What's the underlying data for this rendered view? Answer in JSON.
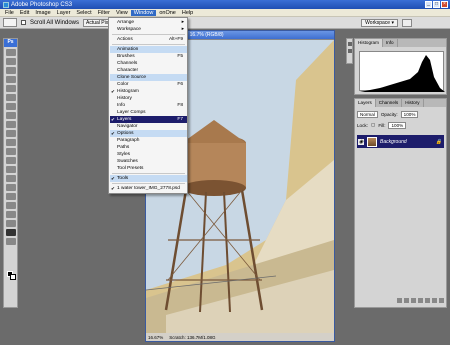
{
  "app": {
    "title": "Adobe Photoshop CS3"
  },
  "menubar": [
    "File",
    "Edit",
    "Image",
    "Layer",
    "Select",
    "Filter",
    "View",
    "Window",
    "onOne",
    "Help"
  ],
  "options": {
    "scroll_all_windows": "Scroll All Windows",
    "actual_pixels": "Actual Pixels",
    "workspace": "Workspace ▾"
  },
  "toolbox": {
    "label": "Ps"
  },
  "document": {
    "title": "IMG_2778.psd @ 16.7% (RGB/8)",
    "zoom": "16.67%",
    "status": "Scratch: 136.7M/1.08G"
  },
  "window_menu": {
    "items": [
      {
        "label": "Arrange",
        "shortcut": "",
        "submenu": true,
        "checked": false,
        "state": ""
      },
      {
        "label": "Workspace",
        "shortcut": "",
        "submenu": true,
        "checked": false,
        "state": ""
      },
      {
        "label": "Actions",
        "shortcut": "Alt+F9",
        "submenu": false,
        "checked": false,
        "state": ""
      },
      {
        "label": "Animation",
        "shortcut": "",
        "submenu": false,
        "checked": false,
        "state": "hl"
      },
      {
        "label": "Brushes",
        "shortcut": "F5",
        "submenu": false,
        "checked": false,
        "state": ""
      },
      {
        "label": "Channels",
        "shortcut": "",
        "submenu": false,
        "checked": false,
        "state": ""
      },
      {
        "label": "Character",
        "shortcut": "",
        "submenu": false,
        "checked": false,
        "state": ""
      },
      {
        "label": "Clone Source",
        "shortcut": "",
        "submenu": false,
        "checked": false,
        "state": "hl"
      },
      {
        "label": "Color",
        "shortcut": "F6",
        "submenu": false,
        "checked": false,
        "state": ""
      },
      {
        "label": "Histogram",
        "shortcut": "",
        "submenu": false,
        "checked": true,
        "state": ""
      },
      {
        "label": "History",
        "shortcut": "",
        "submenu": false,
        "checked": false,
        "state": ""
      },
      {
        "label": "Info",
        "shortcut": "F8",
        "submenu": false,
        "checked": false,
        "state": ""
      },
      {
        "label": "Layer Comps",
        "shortcut": "",
        "submenu": false,
        "checked": false,
        "state": ""
      },
      {
        "label": "Layers",
        "shortcut": "F7",
        "submenu": false,
        "checked": true,
        "state": "sel"
      },
      {
        "label": "Navigator",
        "shortcut": "",
        "submenu": false,
        "checked": false,
        "state": ""
      },
      {
        "label": "Options",
        "shortcut": "",
        "submenu": false,
        "checked": true,
        "state": "hl"
      },
      {
        "label": "Paragraph",
        "shortcut": "",
        "submenu": false,
        "checked": false,
        "state": ""
      },
      {
        "label": "Paths",
        "shortcut": "",
        "submenu": false,
        "checked": false,
        "state": ""
      },
      {
        "label": "Styles",
        "shortcut": "",
        "submenu": false,
        "checked": false,
        "state": ""
      },
      {
        "label": "Swatches",
        "shortcut": "",
        "submenu": false,
        "checked": false,
        "state": ""
      },
      {
        "label": "Tool Presets",
        "shortcut": "",
        "submenu": false,
        "checked": false,
        "state": ""
      },
      {
        "label": "Tools",
        "shortcut": "",
        "submenu": false,
        "checked": true,
        "state": "hl"
      },
      {
        "label": "1 water tower_IMG_2778.psd",
        "shortcut": "",
        "submenu": false,
        "checked": true,
        "state": ""
      }
    ]
  },
  "histogram_panel": {
    "tabs": [
      "Histogram",
      "Info"
    ]
  },
  "layers_panel": {
    "tabs": [
      "Layers",
      "Channels",
      "History"
    ],
    "blend_mode": "Normal",
    "opacity_label": "Opacity:",
    "opacity": "100%",
    "lock_label": "Lock:",
    "fill_label": "Fill:",
    "fill": "100%",
    "layer_name": "Background"
  }
}
